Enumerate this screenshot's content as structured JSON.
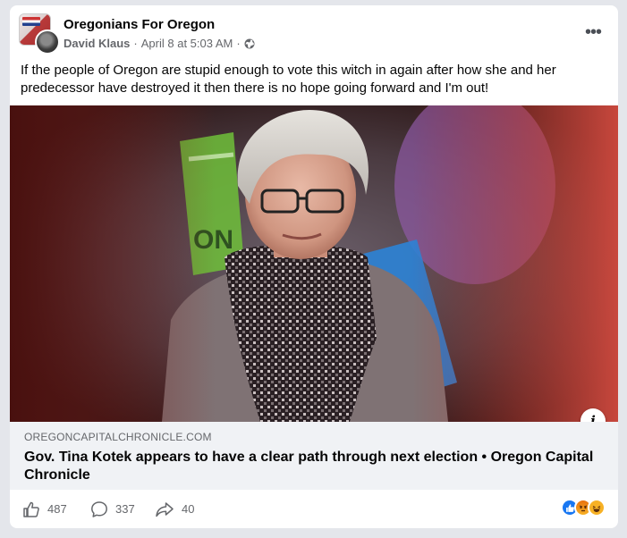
{
  "post": {
    "group_name": "Oregonians For Oregon",
    "author": "David Klaus",
    "separator": "·",
    "timestamp": "April 8 at 5:03 AM",
    "separator2": "·",
    "audience_icon": "globe-icon",
    "more_icon": "more-options-icon",
    "more_label": "•••",
    "text": "If the people of Oregon are stupid enough to vote this witch in again after how she and her predecessor have destroyed it then there is no hope going forward and I'm out!"
  },
  "link": {
    "domain": "OREGONCAPITALCHRONICLE.COM",
    "title": "Gov. Tina Kotek appears to have a clear path through next election • Oregon Capital Chronicle",
    "info_label": "i"
  },
  "actions": {
    "like_count": "487",
    "comment_count": "337",
    "share_count": "40"
  },
  "reactions": [
    "like",
    "angry",
    "haha"
  ],
  "colors": {
    "text_primary": "#050505",
    "text_secondary": "#65676b",
    "like_blue": "#1877f2",
    "card_bg": "#ffffff",
    "page_bg": "#e4e6eb"
  }
}
